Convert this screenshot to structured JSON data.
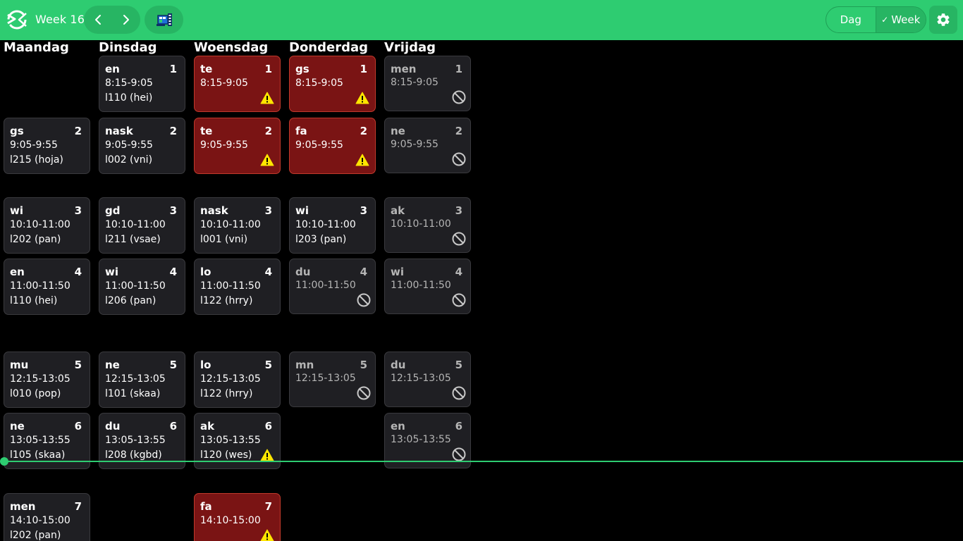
{
  "header": {
    "week_label": "Week 16",
    "view_dag": "Dag",
    "view_week": "Week",
    "view_week_check": "✓"
  },
  "colors": {
    "accent": "#2ecc71",
    "card_bg": "#1f1f23",
    "warning_card_bg": "#7a1414",
    "warning_icon": "#ffe600"
  },
  "days": [
    {
      "name": "Maandag",
      "lessons": [
        {
          "slot": 1,
          "empty": true
        },
        {
          "slot": 2,
          "subject": "gs",
          "number": "2",
          "time": "9:05-9:55",
          "room": "l215 (hoja)",
          "status": "normal"
        },
        {
          "slot": 3,
          "subject": "wi",
          "number": "3",
          "time": "10:10-11:00",
          "room": "l202 (pan)",
          "status": "normal"
        },
        {
          "slot": 4,
          "subject": "en",
          "number": "4",
          "time": "11:00-11:50",
          "room": "l110 (hei)",
          "status": "normal"
        },
        {
          "slot": 5,
          "subject": "mu",
          "number": "5",
          "time": "12:15-13:05",
          "room": "l010 (pop)",
          "status": "normal"
        },
        {
          "slot": 6,
          "subject": "ne",
          "number": "6",
          "time": "13:05-13:55",
          "room": "l105 (skaa)",
          "status": "normal"
        },
        {
          "slot": 7,
          "subject": "men",
          "number": "7",
          "time": "14:10-15:00",
          "room": "l202 (pan)",
          "status": "normal"
        }
      ]
    },
    {
      "name": "Dinsdag",
      "lessons": [
        {
          "slot": 1,
          "subject": "en",
          "number": "1",
          "time": "8:15-9:05",
          "room": "l110 (hei)",
          "status": "normal"
        },
        {
          "slot": 2,
          "subject": "nask",
          "number": "2",
          "time": "9:05-9:55",
          "room": "l002 (vni)",
          "status": "normal"
        },
        {
          "slot": 3,
          "subject": "gd",
          "number": "3",
          "time": "10:10-11:00",
          "room": "l211 (vsae)",
          "status": "normal"
        },
        {
          "slot": 4,
          "subject": "wi",
          "number": "4",
          "time": "11:00-11:50",
          "room": "l206 (pan)",
          "status": "normal"
        },
        {
          "slot": 5,
          "subject": "ne",
          "number": "5",
          "time": "12:15-13:05",
          "room": "l101 (skaa)",
          "status": "normal"
        },
        {
          "slot": 6,
          "subject": "du",
          "number": "6",
          "time": "13:05-13:55",
          "room": "l208 (kgbd)",
          "status": "normal"
        }
      ]
    },
    {
      "name": "Woensdag",
      "lessons": [
        {
          "slot": 1,
          "subject": "te",
          "number": "1",
          "time": "8:15-9:05",
          "room": "",
          "status": "warning"
        },
        {
          "slot": 2,
          "subject": "te",
          "number": "2",
          "time": "9:05-9:55",
          "room": "",
          "status": "warning"
        },
        {
          "slot": 3,
          "subject": "nask",
          "number": "3",
          "time": "10:10-11:00",
          "room": "l001 (vni)",
          "status": "normal"
        },
        {
          "slot": 4,
          "subject": "lo",
          "number": "4",
          "time": "11:00-11:50",
          "room": "l122 (hrry)",
          "status": "normal"
        },
        {
          "slot": 5,
          "subject": "lo",
          "number": "5",
          "time": "12:15-13:05",
          "room": "l122 (hrry)",
          "status": "normal"
        },
        {
          "slot": 6,
          "subject": "ak",
          "number": "6",
          "time": "13:05-13:55",
          "room": "l120 (wes)",
          "status": "normal-warning"
        },
        {
          "slot": 7,
          "subject": "fa",
          "number": "7",
          "time": "14:10-15:00",
          "room": "",
          "status": "warning"
        }
      ]
    },
    {
      "name": "Donderdag",
      "lessons": [
        {
          "slot": 1,
          "subject": "gs",
          "number": "1",
          "time": "8:15-9:05",
          "room": "",
          "status": "warning"
        },
        {
          "slot": 2,
          "subject": "fa",
          "number": "2",
          "time": "9:05-9:55",
          "room": "",
          "status": "warning"
        },
        {
          "slot": 3,
          "subject": "wi",
          "number": "3",
          "time": "10:10-11:00",
          "room": "l203 (pan)",
          "status": "normal"
        },
        {
          "slot": 4,
          "subject": "du",
          "number": "4",
          "time": "11:00-11:50",
          "room": "",
          "status": "cancelled"
        },
        {
          "slot": 5,
          "subject": "mn",
          "number": "5",
          "time": "12:15-13:05",
          "room": "",
          "status": "cancelled"
        }
      ]
    },
    {
      "name": "Vrijdag",
      "lessons": [
        {
          "slot": 1,
          "subject": "men",
          "number": "1",
          "time": "8:15-9:05",
          "room": "",
          "status": "cancelled"
        },
        {
          "slot": 2,
          "subject": "ne",
          "number": "2",
          "time": "9:05-9:55",
          "room": "",
          "status": "cancelled"
        },
        {
          "slot": 3,
          "subject": "ak",
          "number": "3",
          "time": "10:10-11:00",
          "room": "",
          "status": "cancelled"
        },
        {
          "slot": 4,
          "subject": "wi",
          "number": "4",
          "time": "11:00-11:50",
          "room": "",
          "status": "cancelled"
        },
        {
          "slot": 5,
          "subject": "du",
          "number": "5",
          "time": "12:15-13:05",
          "room": "",
          "status": "cancelled"
        },
        {
          "slot": 6,
          "subject": "en",
          "number": "6",
          "time": "13:05-13:55",
          "room": "",
          "status": "cancelled"
        }
      ]
    }
  ]
}
